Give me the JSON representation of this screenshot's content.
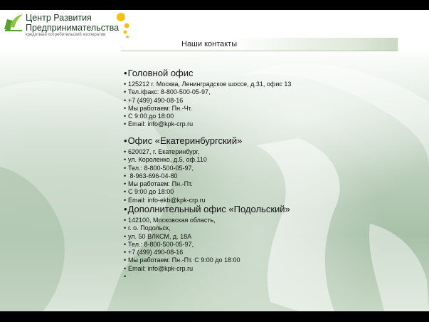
{
  "header": {
    "brand_line1": "Центр Развития",
    "brand_line2": "Предпринимательства",
    "tagline": "кредитный потребительский кооператив",
    "logo_icon": "kpk-logo-icon",
    "accent": "#f2c21b"
  },
  "title": "Наши контакты",
  "bullet": "•",
  "sections": [
    {
      "heading": "Головной офис",
      "lines": [
        "125212 г. Москва, Ленинградское шоссе, д.31, офис 13",
        "Тел./факс: 8-800-500-05-97,",
        "+7 (499) 490-08-16",
        "Мы работаем: Пн.-Чт.",
        "С  9:00 до 18:00",
        "Email: info@kpk-crp.ru"
      ]
    },
    {
      "heading": "Офис «Екатеринбургский»",
      "lines": [
        "620027, г. Екатеринбург,",
        "ул. Короленко, д.5, оф.110",
        "Тел.: 8-800-500-05-97,",
        " 8-963-696-04-80",
        "Мы работаем: Пн.-Пт.",
        "С 9:00 до 18:00",
        "Email: info-ekb@kpk-crp.ru"
      ]
    },
    {
      "heading": "Дополнительный офис «Подольский»",
      "lines": [
        "142100, Московская область,",
        "г. о. Подольск,",
        "ул. 50 ВЛКСМ, д. 18А",
        "Тел.: 8-800-500-05-97,",
        "+7 (499) 490-08-16",
        "Мы работаем: Пн.-Пт. С 9:00 до 18:00",
        "Email: info@kpk-crp.ru",
        ""
      ]
    }
  ]
}
